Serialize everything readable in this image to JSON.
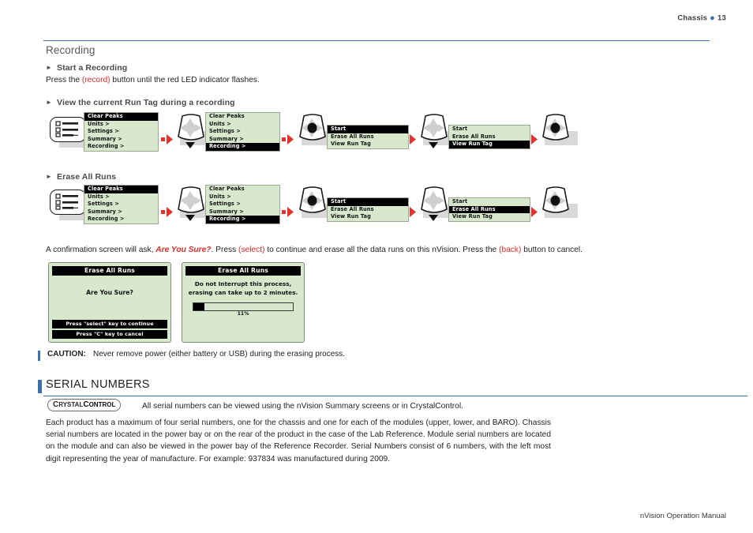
{
  "runhead": {
    "label": "Chassis",
    "page": "13"
  },
  "footer": {
    "text": "nVision Operation Manual"
  },
  "recording": {
    "section_title": "Recording",
    "start": {
      "heading": "Start a Recording",
      "text_before": "Press the ",
      "key": "record",
      "text_after": " button until the red LED indicator flashes."
    },
    "view_run_tag": {
      "heading": "View the current Run Tag during a recording"
    },
    "erase_all_runs": {
      "heading": "Erase All Runs"
    }
  },
  "confirm_paragraph": {
    "p1": "A confirmation screen will ask, ",
    "emphasis": "Are You Sure?",
    "p2": ". Press ",
    "key1": "select",
    "p3": " to continue and erase all the data runs on this nVision. Press the ",
    "key2": "back",
    "p4": " button to cancel."
  },
  "caution": {
    "label": "CAUTION:",
    "text": "Never remove power (either battery or USB) during the erasing process."
  },
  "serial_numbers": {
    "heading": "SERIAL NUMBERS",
    "badge": {
      "part1": "C",
      "part2": "RYSTAL",
      "part3": "C",
      "part4": "ONTROL"
    },
    "badge_line": "All serial numbers can be viewed using the nVision Summary screens or in CrystalControl.",
    "paragraph": "Each product has a maximum of four serial numbers, one for the chassis and one for each of the modules (upper, lower, and BARO). Chassis serial numbers are located in the power bay or on the rear of the product in the case of the Lab Reference. Module serial numbers are located on the module and can also be viewed in the power bay of the Reference Recorder. Serial Numbers consist of 6 numbers, with the left most digit representing the year of manufacture. For example: 937834 was manufactured during 2009."
  },
  "menus": {
    "main": [
      {
        "label": "Clear Peaks",
        "highlight": true
      },
      {
        "label": "Units >",
        "highlight": false
      },
      {
        "label": "Settings >",
        "highlight": false
      },
      {
        "label": "Summary >",
        "highlight": false
      },
      {
        "label": "Recording >",
        "highlight": false
      }
    ],
    "main_recording_selected": [
      {
        "label": "Clear Peaks",
        "highlight": false
      },
      {
        "label": "Units >",
        "highlight": false
      },
      {
        "label": "Settings >",
        "highlight": false
      },
      {
        "label": "Summary >",
        "highlight": false
      },
      {
        "label": "Recording >",
        "highlight": true
      }
    ],
    "recording_start": [
      {
        "label": "Start",
        "highlight": true
      },
      {
        "label": "Erase All Runs",
        "highlight": false
      },
      {
        "label": "View Run Tag",
        "highlight": false
      }
    ],
    "recording_view_run_tag": [
      {
        "label": "Start",
        "highlight": false
      },
      {
        "label": "Erase All Runs",
        "highlight": false
      },
      {
        "label": "View Run Tag",
        "highlight": true
      }
    ],
    "recording_erase_all_runs": [
      {
        "label": "Start",
        "highlight": false
      },
      {
        "label": "Erase All Runs",
        "highlight": true
      },
      {
        "label": "View Run Tag",
        "highlight": false
      }
    ]
  },
  "panels": {
    "are_you_sure": {
      "title": "Erase All Runs",
      "question": "Are You Sure?",
      "button_continue": "Press \"select\" key to continue",
      "button_cancel": "Press \"C\" key to cancel"
    },
    "erasing": {
      "title": "Erase All Runs",
      "message_line1": "Do not Interrupt this process,",
      "message_line2": "erasing can take up to 2 minutes.",
      "percent_label": "11%",
      "percent_value": 11
    }
  },
  "colors": {
    "accent_blue": "#3a6fb0",
    "key_red": "#e02b2b",
    "lcd_green": "#d7e8cd",
    "arrow_red": "#e8312a"
  }
}
